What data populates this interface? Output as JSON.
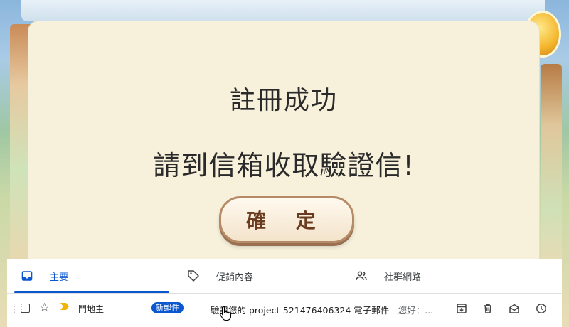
{
  "dialog": {
    "title": "註冊成功",
    "message": "請到信箱收取驗證信!",
    "confirm_label": "確 定"
  },
  "mail": {
    "tabs": [
      {
        "label": "主要",
        "icon": "inbox-icon",
        "active": true
      },
      {
        "label": "促銷內容",
        "icon": "tag-icon",
        "active": false
      },
      {
        "label": "社群網路",
        "icon": "people-icon",
        "active": false
      }
    ],
    "row": {
      "sender": "鬥地主",
      "badge": "新郵件",
      "subject": "驗證您的 project-521476406324 電子郵件",
      "snippet": " - 您好：...",
      "actions": [
        "archive-icon",
        "delete-icon",
        "mark-unread-icon",
        "snooze-icon"
      ]
    }
  },
  "colors": {
    "accent": "#0b57d0",
    "dialog_bg": "#f7f1dc",
    "button_text": "#6b3b1f"
  }
}
